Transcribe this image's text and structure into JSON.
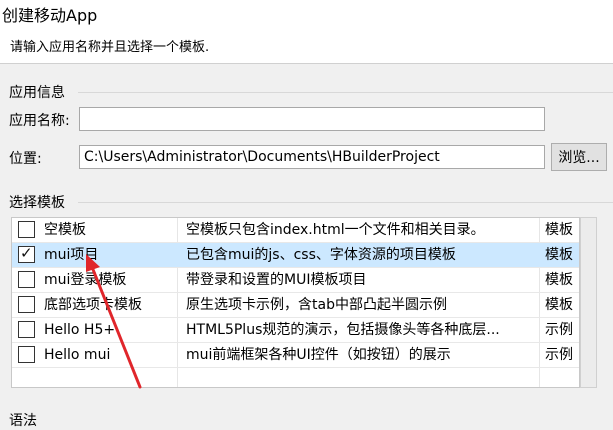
{
  "header": {
    "title": "创建移动App",
    "subtitle": "请输入应用名称并且选择一个模板."
  },
  "app_info": {
    "section_label": "应用信息",
    "name_label": "应用名称:",
    "name_value": "",
    "location_label": "位置:",
    "location_value": "C:\\Users\\Administrator\\Documents\\HBuilderProject",
    "browse_label": "浏览..."
  },
  "templates": {
    "section_label": "选择模板",
    "rows": [
      {
        "name": "空模板",
        "description": "空模板只包含index.html一个文件和相关目录。",
        "type": "模板",
        "checked": false,
        "selected": false
      },
      {
        "name": "mui项目",
        "description": "已包含mui的js、css、字体资源的项目模板",
        "type": "模板",
        "checked": true,
        "selected": true
      },
      {
        "name": "mui登录模板",
        "description": "带登录和设置的MUI模板项目",
        "type": "模板",
        "checked": false,
        "selected": false
      },
      {
        "name": "底部选项卡模板",
        "description": "原生选项卡示例，含tab中部凸起半圆示例",
        "type": "模板",
        "checked": false,
        "selected": false
      },
      {
        "name": "Hello H5+",
        "description": "HTML5Plus规范的演示，包括摄像头等各种底层...",
        "type": "示例",
        "checked": false,
        "selected": false
      },
      {
        "name": "Hello mui",
        "description": "mui前端框架各种UI控件（如按钮）的展示",
        "type": "示例",
        "checked": false,
        "selected": false
      }
    ]
  },
  "syntax": {
    "section_label": "语法"
  },
  "colors": {
    "selected_row": "#cce8ff",
    "annotation_arrow": "#e0262b"
  }
}
